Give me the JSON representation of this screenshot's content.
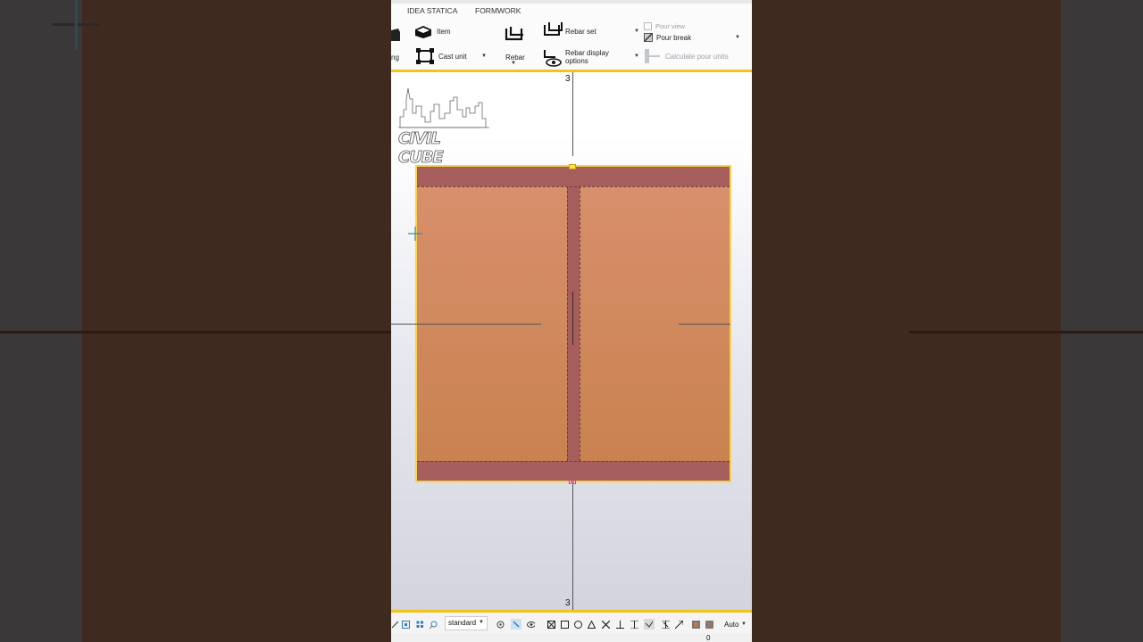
{
  "ribbon": {
    "tabs": [
      "IDEA STATICA",
      "FORMWORK"
    ],
    "item_label": "Item",
    "cast_unit_label": "Cast unit",
    "partial_label": "ng",
    "rebar_label": "Rebar",
    "rebar_set_label": "Rebar set",
    "rebar_display_label_1": "Rebar display",
    "rebar_display_label_2": "options",
    "pour_view_label": "Pour view",
    "pour_break_label": "Pour break",
    "calc_pour_units_label": "Calculate pour units"
  },
  "view": {
    "grid_label_top": "3",
    "grid_label_bottom": "3",
    "logo_text": "CIVIL CUBE"
  },
  "statusbar": {
    "standard_select": "standard",
    "auto_select": "Auto",
    "coord_readout": "0"
  },
  "colors": {
    "accent": "#f0c419",
    "flange": "#a55e5c",
    "web": "#d08a62",
    "outer": "#3e2a1f"
  }
}
